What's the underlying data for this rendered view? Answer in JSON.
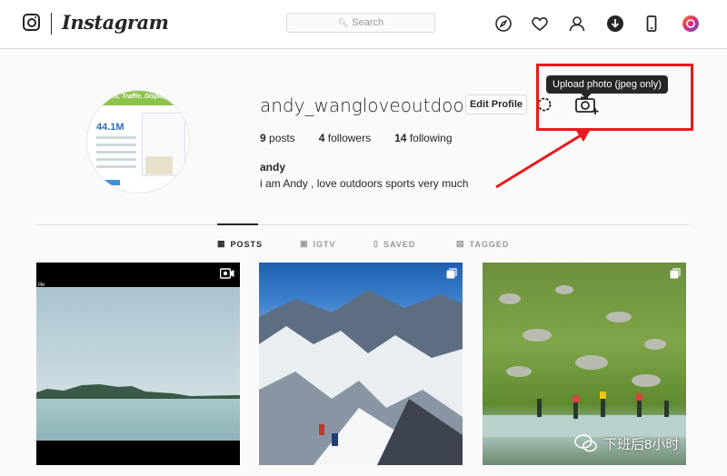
{
  "nav": {
    "brand": "Instagram",
    "search_placeholder": "Search",
    "icons": [
      "instagram-glyph-icon",
      "search-icon",
      "compass-icon",
      "heart-icon",
      "person-icon",
      "download-icon",
      "phone-icon",
      "extension-icon"
    ]
  },
  "profile": {
    "username": "andy_wangloveoutdoor",
    "edit_label": "Edit Profile",
    "tooltip": "Upload photo (jpeg only)",
    "stats": {
      "posts_count": "9",
      "posts_label": "posts",
      "followers_count": "4",
      "followers_label": "followers",
      "following_count": "14",
      "following_label": "following"
    },
    "full_name": "andy",
    "bio": "i am Andy , love outdoors sports very much",
    "avatar": {
      "banner_text": "nks, Traffic, Display",
      "stat": "44.1M"
    }
  },
  "tabs": [
    {
      "label": "POSTS",
      "icon": "grid-icon",
      "active": true
    },
    {
      "label": "IGTV",
      "icon": "tv-icon",
      "active": false
    },
    {
      "label": "SAVED",
      "icon": "bookmark-icon",
      "active": false
    },
    {
      "label": "TAGGED",
      "icon": "tag-icon",
      "active": false
    }
  ],
  "posts": [
    {
      "type": "video",
      "badge": "video-icon",
      "caption_fragment": "ille"
    },
    {
      "type": "multi",
      "badge": "carousel-icon"
    },
    {
      "type": "multi",
      "badge": "carousel-icon"
    }
  ],
  "watermark": "下班后8小时",
  "colors": {
    "highlight_red": "#e8191c",
    "tooltip_bg": "#262626",
    "link_text": "#262626"
  }
}
